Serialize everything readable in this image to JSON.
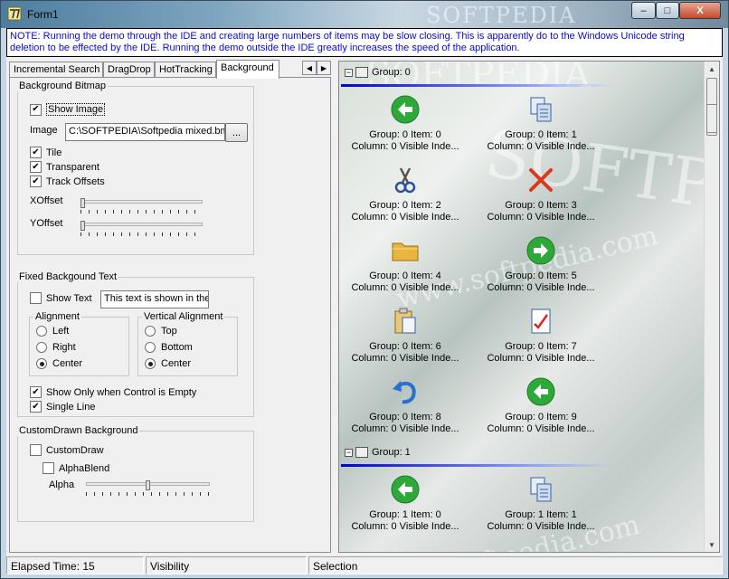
{
  "window": {
    "title": "Form1",
    "watermark": "SOFTPEDIA",
    "min_label": "–",
    "max_label": "□",
    "close_label": "X"
  },
  "note": "NOTE:  Running the demo through the IDE and creating large numbers of items may be slow closing.  This is apparently do to the Windows Unicode string deletion to be effected by the IDE.  Running the demo outside the IDE greatly increases the speed of the application.",
  "tabs": [
    "Incremental Search",
    "DragDrop",
    "HotTracking",
    "Background"
  ],
  "tab_scroll": {
    "left": "◀",
    "right": "▶"
  },
  "background_bitmap": {
    "title": "Background Bitmap",
    "show_image": {
      "label": "Show Image",
      "checked": true
    },
    "image_label": "Image",
    "image_path": "C:\\SOFTPEDIA\\Softpedia mixed.bmp",
    "browse_label": "...",
    "tile": {
      "label": "Tile",
      "checked": true
    },
    "transparent": {
      "label": "Transparent",
      "checked": true
    },
    "track_offsets": {
      "label": "Track Offsets",
      "checked": true
    },
    "xoffset_label": "XOffset",
    "yoffset_label": "YOffset",
    "xoffset_value": 0,
    "yoffset_value": 0
  },
  "fixed_text": {
    "title": "Fixed Backgound Text",
    "show_text": {
      "label": "Show Text",
      "checked": false
    },
    "text_value": "This text is shown in the",
    "alignment": {
      "title": "Alignment",
      "options": [
        "Left",
        "Right",
        "Center"
      ],
      "selected": "Center"
    },
    "vertical_alignment": {
      "title": "Vertical Alignment",
      "options": [
        "Top",
        "Bottom",
        "Center"
      ],
      "selected": "Center"
    },
    "show_only_empty": {
      "label": "Show Only when Control is Empty",
      "checked": true
    },
    "single_line": {
      "label": "Single Line",
      "checked": true
    }
  },
  "custom_drawn": {
    "title": "CustomDrawn Background",
    "custom_draw": {
      "label": "CustomDraw",
      "checked": false
    },
    "alpha_blend": {
      "label": "AlphaBlend",
      "checked": false
    },
    "alpha_label": "Alpha",
    "alpha_value": 0.5
  },
  "status": {
    "elapsed": "Elapsed Time: 15",
    "visibility": "Visibility",
    "selection": "Selection"
  },
  "listview": {
    "watermark_big": "SOFTPEDIA",
    "watermark_url": "www.softpedia.com",
    "groups": [
      {
        "header": "Group: 0",
        "items": [
          {
            "line1": "Group: 0 Item: 0",
            "line2": "Column: 0 Visible Inde...",
            "icon": "back-arrow-icon"
          },
          {
            "line1": "Group: 0 Item: 1",
            "line2": "Column: 0 Visible Inde...",
            "icon": "copy-icon"
          },
          {
            "line1": "Group: 0 Item: 2",
            "line2": "Column: 0 Visible Inde...",
            "icon": "cut-icon"
          },
          {
            "line1": "Group: 0 Item: 3",
            "line2": "Column: 0 Visible Inde...",
            "icon": "delete-icon"
          },
          {
            "line1": "Group: 0 Item: 4",
            "line2": "Column: 0 Visible Inde...",
            "icon": "folder-icon"
          },
          {
            "line1": "Group: 0 Item: 5",
            "line2": "Column: 0 Visible Inde...",
            "icon": "forward-arrow-icon"
          },
          {
            "line1": "Group: 0 Item: 6",
            "line2": "Column: 0 Visible Inde...",
            "icon": "paste-icon"
          },
          {
            "line1": "Group: 0 Item: 7",
            "line2": "Column: 0 Visible Inde...",
            "icon": "properties-icon"
          },
          {
            "line1": "Group: 0 Item: 8",
            "line2": "Column: 0 Visible Inde...",
            "icon": "undo-icon"
          },
          {
            "line1": "Group: 0 Item: 9",
            "line2": "Column: 0 Visible Inde...",
            "icon": "back-arrow-icon"
          }
        ]
      },
      {
        "header": "Group: 1",
        "items": [
          {
            "line1": "Group: 1 Item: 0",
            "line2": "Column: 0 Visible Inde...",
            "icon": "back-arrow-icon"
          },
          {
            "line1": "Group: 1 Item: 1",
            "line2": "Column: 0 Visible Inde...",
            "icon": "copy-icon"
          }
        ]
      }
    ]
  }
}
